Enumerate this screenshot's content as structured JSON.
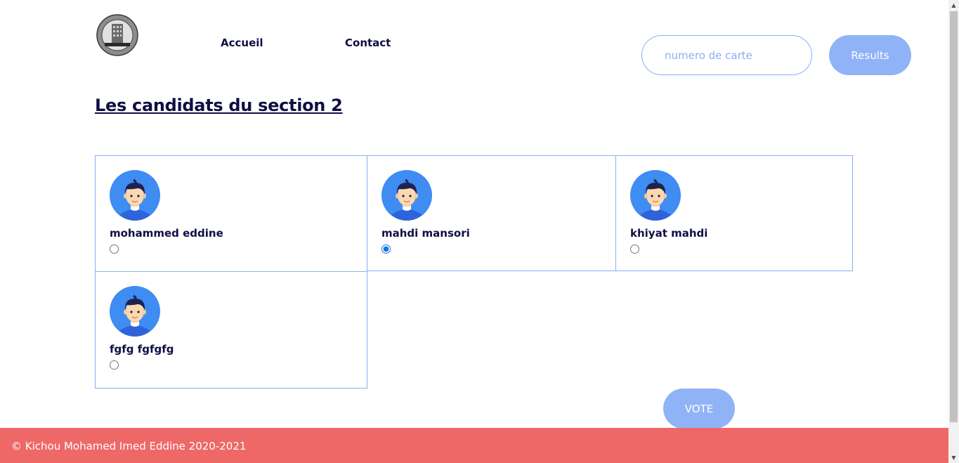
{
  "header": {
    "nav": [
      {
        "label": "Accueil"
      },
      {
        "label": "Contact"
      }
    ],
    "card_input": {
      "placeholder": "numero de carte",
      "value": ""
    },
    "results_label": "Results"
  },
  "main": {
    "title": "Les candidats du section 2",
    "candidates": [
      {
        "name": "mohammed eddine",
        "selected": false
      },
      {
        "name": "mahdi mansori",
        "selected": true
      },
      {
        "name": "khiyat mahdi",
        "selected": false
      },
      {
        "name": "fgfg fgfgfg",
        "selected": false
      }
    ],
    "vote_label": "VOTE"
  },
  "footer": {
    "text": "© Kichou Mohamed Imed Eddine 2020-2021"
  },
  "colors": {
    "accent": "#90b3f7",
    "border": "#8aaef5",
    "footer_bg": "#ee6868",
    "text_dark": "#0f0f45"
  }
}
